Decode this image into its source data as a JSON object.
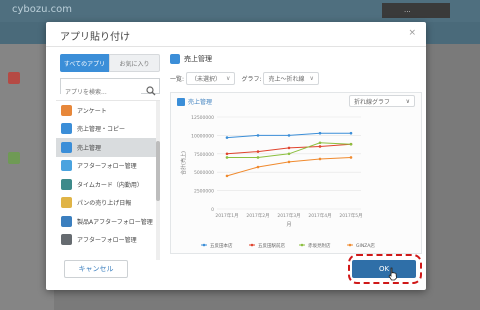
{
  "background": {
    "logo": "cybozu.com",
    "user_label": "...",
    "widgets": [
      "",
      "",
      ""
    ]
  },
  "dialog": {
    "title": "アプリ貼り付け",
    "close_label": "×"
  },
  "left_panel": {
    "tabs": [
      {
        "label": "すべてのアプリ"
      },
      {
        "label": "お気に入り"
      }
    ],
    "search": {
      "placeholder": "アプリを検索..."
    },
    "apps": [
      {
        "label": "アンケート",
        "color": "#e7873a"
      },
      {
        "label": "売上管理・コピー",
        "color": "#3b8ed8"
      },
      {
        "label": "売上管理",
        "color": "#3b8ed8"
      },
      {
        "label": "アフターフォロー管理",
        "color": "#4aa3df"
      },
      {
        "label": "タイムカード（内勤用）",
        "color": "#3d8a8a"
      },
      {
        "label": "パンの売り上げ日報",
        "color": "#e0b446"
      },
      {
        "label": "製品Aアフターフォロー管理",
        "color": "#3b7fbf"
      },
      {
        "label": "アフターフォロー管理",
        "color": "#666b70"
      }
    ],
    "selected_index": 2
  },
  "right_panel": {
    "app_title": "売上管理",
    "list_label": "一覧:",
    "list_value": "（未選択）",
    "graph_label": "グラフ:",
    "graph_value": "売上～折れ線",
    "chart_title": "売上管理",
    "chart_type_label": "折れ線グラフ",
    "chevron": "∨"
  },
  "chart_data": {
    "type": "line",
    "ylabel": "合計(売上)",
    "xlabel": "月",
    "ylim": [
      0,
      12500000
    ],
    "y_ticks": [
      "12500000",
      "10000000",
      "7500000",
      "5000000",
      "2500000",
      "0"
    ],
    "categories": [
      "2017年1月",
      "2017年2月",
      "2017年3月",
      "2017年4月",
      "2017年5月"
    ],
    "series": [
      {
        "name": "五反田本店",
        "color": "#3b8ed8",
        "values": [
          9700000,
          10000000,
          10000000,
          10300000,
          10300000
        ]
      },
      {
        "name": "五反田駅前店",
        "color": "#e0442e",
        "values": [
          7500000,
          7800000,
          8300000,
          8500000,
          8800000
        ]
      },
      {
        "name": "赤坂見附店",
        "color": "#8cbf3f",
        "values": [
          7000000,
          7000000,
          7500000,
          9000000,
          8800000
        ]
      },
      {
        "name": "GINZA店",
        "color": "#f08a2e",
        "values": [
          4500000,
          5700000,
          6400000,
          6800000,
          7000000
        ]
      }
    ],
    "grid": true,
    "legend": "bottom"
  },
  "footer": {
    "cancel_label": "キャンセル",
    "ok_label": "OK"
  }
}
